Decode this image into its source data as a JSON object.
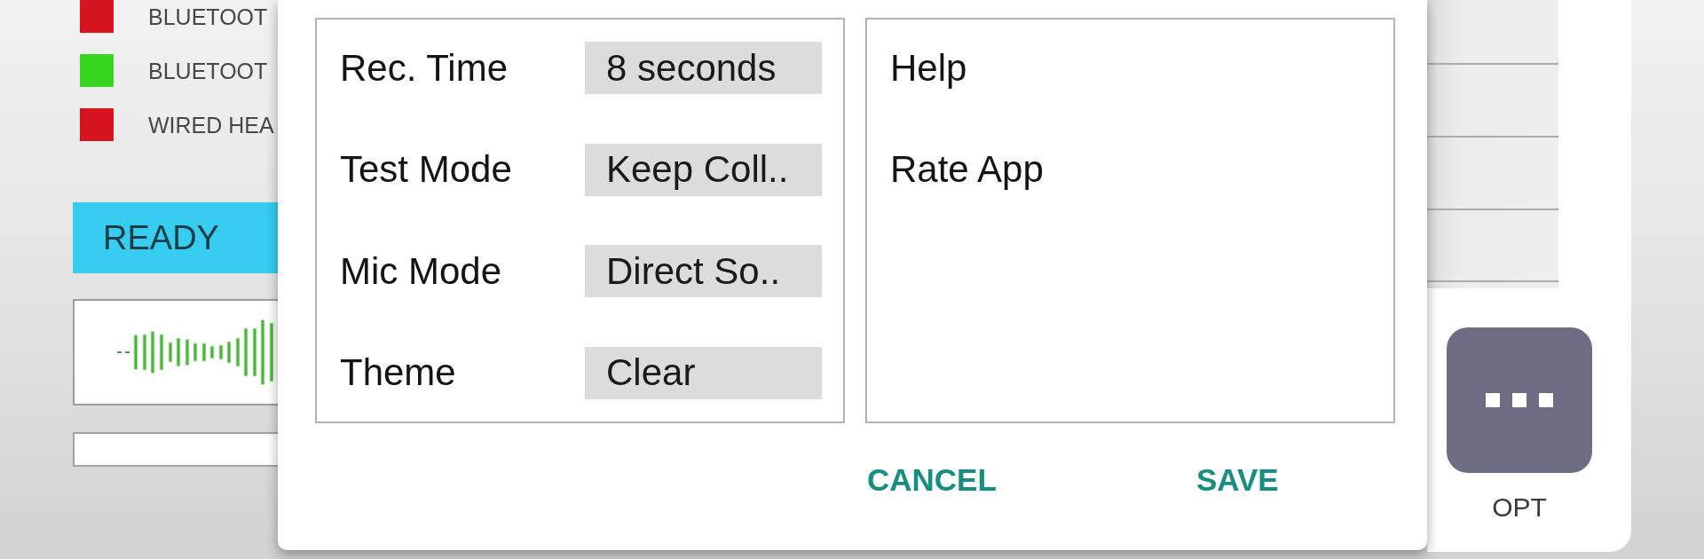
{
  "status_list": [
    {
      "label": "BLUETOOT",
      "color": "#d5141d"
    },
    {
      "label": "BLUETOOT",
      "color": "#36d51e"
    },
    {
      "label": "WIRED HEA",
      "color": "#d5141d"
    }
  ],
  "recorder": {
    "status": "READY"
  },
  "dialog": {
    "settings": [
      {
        "label": "Rec. Time",
        "value": "8 seconds"
      },
      {
        "label": "Test Mode",
        "value": "Keep Coll.."
      },
      {
        "label": "Mic Mode",
        "value": "Direct So.."
      },
      {
        "label": "Theme",
        "value": "Clear"
      }
    ],
    "menu": [
      {
        "label": "Help"
      },
      {
        "label": "Rate App"
      }
    ],
    "buttons": [
      "CANCEL",
      "SAVE"
    ]
  },
  "side_panel": {
    "options_button": {
      "label": "OPT"
    }
  }
}
